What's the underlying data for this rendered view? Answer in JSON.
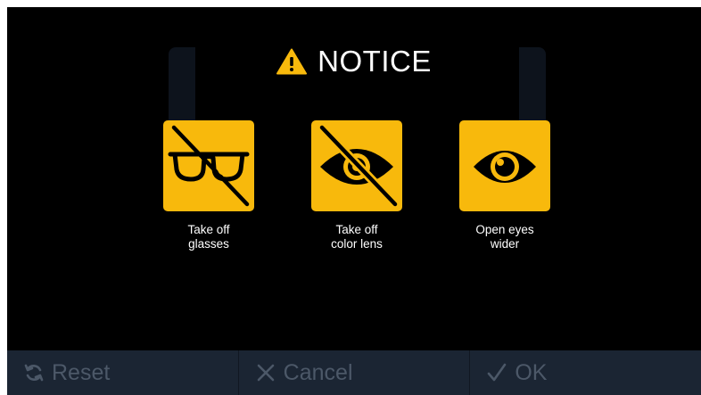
{
  "dialog": {
    "title": "NOTICE",
    "title_icon": "warning-triangle-icon"
  },
  "instructions": [
    {
      "icon": "no-glasses-icon",
      "line1": "Take off",
      "line2": "glasses"
    },
    {
      "icon": "no-color-lens-icon",
      "line1": "Take off",
      "line2": "color lens"
    },
    {
      "icon": "open-eye-icon",
      "line1": "Open eyes",
      "line2": "wider"
    }
  ],
  "footer": {
    "reset_label": "Reset",
    "reset_icon": "refresh-icon",
    "cancel_label": "Cancel",
    "cancel_icon": "close-icon",
    "ok_label": "OK",
    "ok_icon": "checkmark-icon"
  },
  "colors": {
    "accent": "#f8b90c",
    "background": "#000000",
    "bar": "#1b2533",
    "disabled_text": "#4c5868"
  }
}
